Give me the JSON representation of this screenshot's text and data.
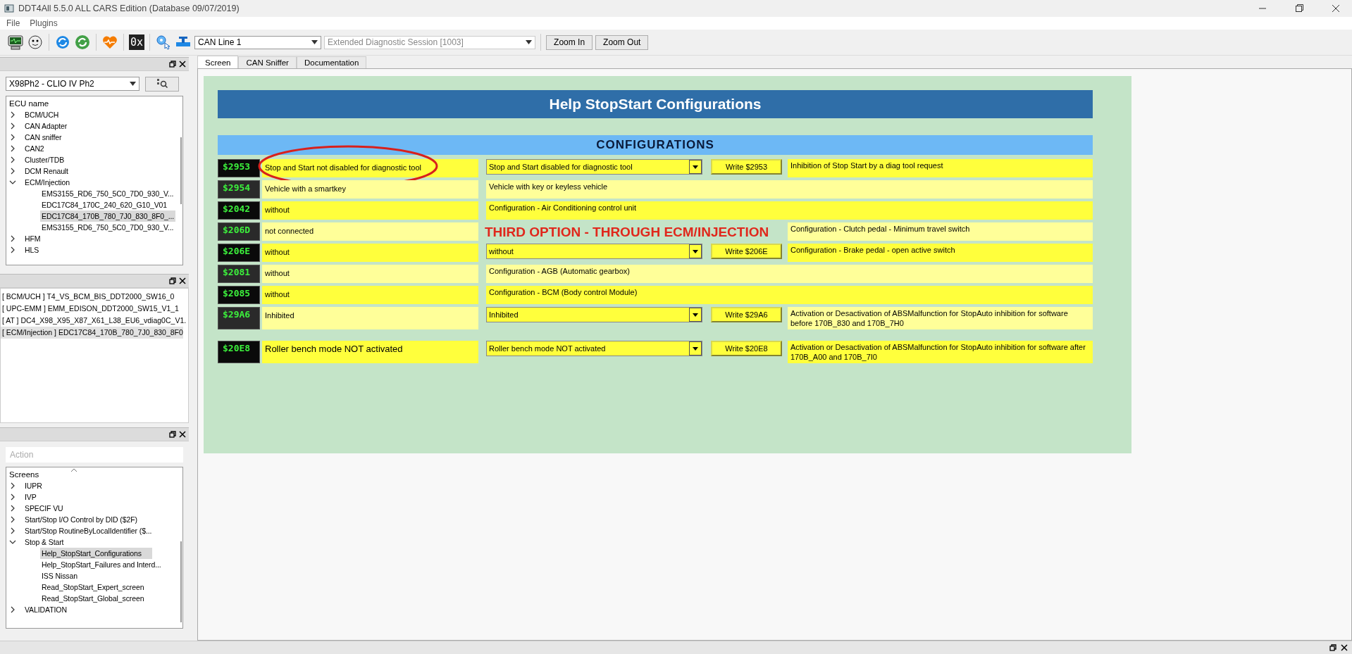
{
  "window": {
    "title": "DDT4All 5.5.0 ALL CARS Edition (Database 09/07/2019)"
  },
  "menu": [
    {
      "label": "File"
    },
    {
      "label": "Plugins"
    }
  ],
  "toolbar": {
    "hex_label": "0x",
    "can_line": "CAN Line 1",
    "session": {
      "value": "Extended Diagnostic Session [1003]",
      "disabled": true
    },
    "buttons": [
      {
        "label": "Zoom In"
      },
      {
        "label": "Zoom Out"
      }
    ]
  },
  "ecu_panel": {
    "vehicle": "X98Ph2 - CLIO IV Ph2",
    "tree_header": "ECU name",
    "tree": [
      {
        "label": "BCM/UCH",
        "expanded": false,
        "selected": false
      },
      {
        "label": "CAN Adapter",
        "expanded": false,
        "selected": false
      },
      {
        "label": "CAN sniffer",
        "expanded": false,
        "selected": false
      },
      {
        "label": "CAN2",
        "expanded": false,
        "selected": false
      },
      {
        "label": "Cluster/TDB",
        "expanded": false,
        "selected": false
      },
      {
        "label": "DCM Renault",
        "expanded": false,
        "selected": false
      },
      {
        "label": "ECM/Injection",
        "expanded": true,
        "selected": false,
        "children": [
          {
            "label": "EMS3155_RD6_750_5C0_7D0_930_V...",
            "selected": false
          },
          {
            "label": "EDC17C84_170C_240_620_G10_V01",
            "selected": false
          },
          {
            "label": "EDC17C84_170B_780_7J0_830_8F0_...",
            "selected": true
          },
          {
            "label": "EMS3155_RD6_750_5C0_7D0_930_V...",
            "selected": false
          }
        ]
      },
      {
        "label": "HFM",
        "expanded": false,
        "selected": false
      },
      {
        "label": "HLS",
        "expanded": false,
        "selected": false
      }
    ]
  },
  "loaded_ecus": {
    "items": [
      {
        "label": "[ BCM/UCH ] T4_VS_BCM_BIS_DDT2000_SW16_0",
        "selected": false
      },
      {
        "label": "[ UPC-EMM ] EMM_EDISON_DDT2000_SW15_V1_1",
        "selected": false
      },
      {
        "label": "[ AT ] DC4_X98_X95_X87_X61_L38_EU6_vdiag0C_V1.",
        "selected": false
      },
      {
        "label": "[ ECM/Injection ] EDC17C84_170B_780_7J0_830_8F0",
        "selected": true
      }
    ]
  },
  "screens_panel": {
    "action_placeholder": "Action",
    "tree_header": "Screens",
    "tree": [
      {
        "label": "IUPR",
        "expanded": false,
        "selected": false
      },
      {
        "label": "IVP",
        "expanded": false,
        "selected": false
      },
      {
        "label": "SPECIF VU",
        "expanded": false,
        "selected": false
      },
      {
        "label": "Start/Stop I/O Control by DID ($2F)",
        "expanded": false,
        "selected": false
      },
      {
        "label": "Start/Stop RoutineByLocalIdentifier ($...",
        "expanded": false,
        "selected": false
      },
      {
        "label": "Stop & Start",
        "expanded": true,
        "selected": false,
        "children": [
          {
            "label": "Help_StopStart_Configurations",
            "selected": true
          },
          {
            "label": "Help_StopStart_Failures and Interd...",
            "selected": false
          },
          {
            "label": "ISS Nissan",
            "selected": false
          },
          {
            "label": "Read_StopStart_Expert_screen",
            "selected": false
          },
          {
            "label": "Read_StopStart_Global_screen",
            "selected": false
          }
        ]
      },
      {
        "label": "VALIDATION",
        "expanded": false,
        "selected": false
      }
    ]
  },
  "tabs": [
    {
      "label": "Screen",
      "selected": true
    },
    {
      "label": "CAN Sniffer",
      "selected": false
    },
    {
      "label": "Documentation",
      "selected": false
    }
  ],
  "screen": {
    "title": "Help StopStart Configurations",
    "section": "CONFIGURATIONS",
    "rows": [
      {
        "kind": "write",
        "code": "$2953",
        "value": "Stop and Start not disabled for diagnostic tool",
        "choice": "Stop and Start disabled for diagnostic tool",
        "button": "Write $2953",
        "description": "Inhibition of Stop Start by a diag tool request",
        "circled": true
      },
      {
        "kind": "info",
        "code": "$2954",
        "value": "Vehicle with a smartkey",
        "description": "Vehicle with key or keyless vehicle",
        "circled": false
      },
      {
        "kind": "info",
        "code": "$2042",
        "value": "without",
        "description": "Configuration - Air Conditioning control unit",
        "circled": false
      },
      {
        "kind": "annotated",
        "code": "$206D",
        "value": "not connected",
        "description": "Configuration - Clutch pedal - Minimum travel switch",
        "circled": false,
        "annotation": "THIRD OPTION - THROUGH ECM/INJECTION"
      },
      {
        "kind": "write",
        "code": "$206E",
        "value": "without",
        "choice": "without",
        "button": "Write $206E",
        "description": "Configuration - Brake pedal - open active switch",
        "circled": false
      },
      {
        "kind": "info",
        "code": "$2081",
        "value": "without",
        "description": "Configuration - AGB (Automatic gearbox)",
        "circled": false
      },
      {
        "kind": "info",
        "code": "$2085",
        "value": "without",
        "description": "Configuration - BCM (Body control Module)",
        "circled": false
      },
      {
        "kind": "write",
        "code": "$29A6",
        "value": "Inhibited",
        "choice": "Inhibited",
        "button": "Write $29A6",
        "description": "Activation or Desactivation of ABSMalfunction for StopAuto inhibition for software before 170B_830 and 170B_7H0",
        "circled": false
      },
      {
        "kind": "write",
        "code": "$20E8",
        "value": "Roller bench mode NOT activated",
        "choice": "Roller bench mode NOT activated",
        "button": "Write $20E8",
        "description": "Activation or Desactivation of ABSMalfunction for StopAuto inhibition for software after 170B_A00 and 170B_7I0",
        "circled": false
      }
    ]
  }
}
